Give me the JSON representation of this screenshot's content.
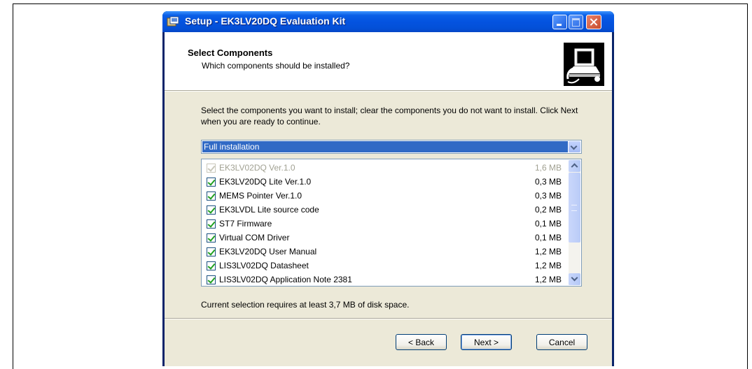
{
  "window": {
    "title": "Setup - EK3LV20DQ Evaluation Kit"
  },
  "header": {
    "title": "Select Components",
    "subtitle": "Which components should be installed?"
  },
  "description": "Select the components you want to install; clear the components you do not want to install. Click Next when you are ready to continue.",
  "install_type": {
    "selected": "Full installation"
  },
  "components": [
    {
      "name": "EK3LV02DQ Ver.1.0",
      "size": "1,6 MB",
      "checked": true,
      "disabled": true
    },
    {
      "name": "EK3LV20DQ Lite Ver.1.0",
      "size": "0,3 MB",
      "checked": true,
      "disabled": false
    },
    {
      "name": "MEMS Pointer Ver.1.0",
      "size": "0,3 MB",
      "checked": true,
      "disabled": false
    },
    {
      "name": "EK3LVDL Lite source code",
      "size": "0,2 MB",
      "checked": true,
      "disabled": false
    },
    {
      "name": "ST7 Firmware",
      "size": "0,1 MB",
      "checked": true,
      "disabled": false
    },
    {
      "name": "Virtual COM Driver",
      "size": "0,1 MB",
      "checked": true,
      "disabled": false
    },
    {
      "name": "EK3LV20DQ User Manual",
      "size": "1,2 MB",
      "checked": true,
      "disabled": false
    },
    {
      "name": "LIS3LV02DQ Datasheet",
      "size": "1,2 MB",
      "checked": true,
      "disabled": false
    },
    {
      "name": "LIS3LV02DQ Application Note 2381",
      "size": "1,2 MB",
      "checked": true,
      "disabled": false
    }
  ],
  "requirement_text": "Current selection requires at least 3,7 MB of disk space.",
  "buttons": {
    "back": "< Back",
    "next": "Next >",
    "cancel": "Cancel"
  },
  "colors": {
    "titlebar": "#0453e0",
    "dialog_bg": "#ece9d8",
    "selection": "#316ac5",
    "check": "#21a121"
  }
}
